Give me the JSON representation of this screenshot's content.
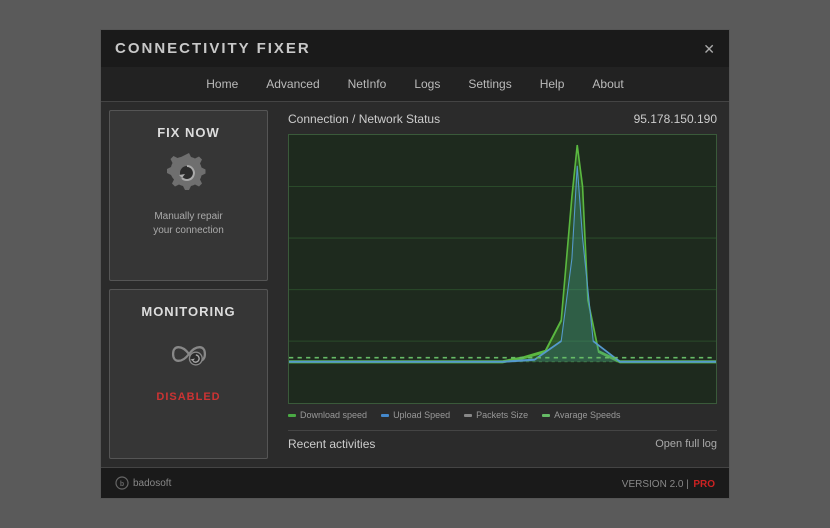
{
  "window": {
    "title": "CONNECTIVITY FIXER",
    "close_label": "✕"
  },
  "nav": {
    "items": [
      {
        "label": "Home",
        "id": "home"
      },
      {
        "label": "Advanced",
        "id": "advanced"
      },
      {
        "label": "NetInfo",
        "id": "netinfo"
      },
      {
        "label": "Logs",
        "id": "logs"
      },
      {
        "label": "Settings",
        "id": "settings"
      },
      {
        "label": "Help",
        "id": "help"
      },
      {
        "label": "About",
        "id": "about"
      }
    ]
  },
  "fix_now_card": {
    "title": "FIX NOW",
    "description_line1": "Manually repair",
    "description_line2": "your connection"
  },
  "monitoring_card": {
    "title": "MONITORING",
    "status": "DISABLED"
  },
  "status": {
    "title": "Connection / Network Status",
    "ip": "95.178.150.190"
  },
  "legend": {
    "items": [
      {
        "label": "Download speed",
        "color": "#4aaa44"
      },
      {
        "label": "Upload Speed",
        "color": "#4488cc"
      },
      {
        "label": "Packets Size",
        "color": "#888888"
      },
      {
        "label": "Avarage Speeds",
        "color": "#66bb66"
      }
    ]
  },
  "recent": {
    "title": "Recent activities",
    "open_log_label": "Open full log"
  },
  "footer": {
    "logo_text": "badosoft",
    "version_text": "VERSION 2.0 |",
    "pro_label": "PRO"
  }
}
